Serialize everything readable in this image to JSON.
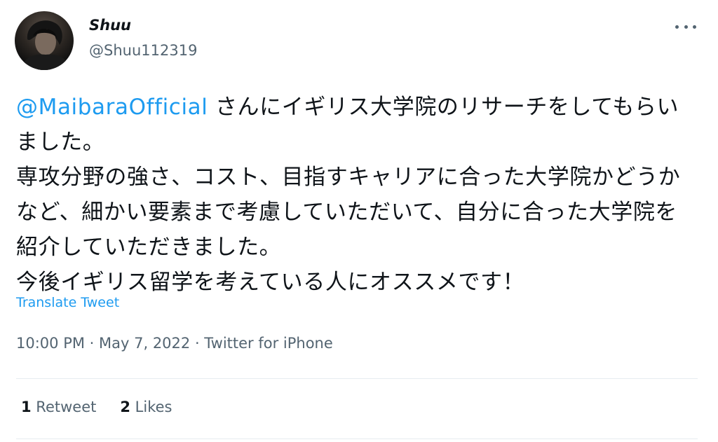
{
  "author": {
    "display_name": "Shuu",
    "handle": "@Shuu112319"
  },
  "tweet": {
    "mention": "@MaibaraOfficial",
    "text": " さんにイギリス大学院のリサーチをしてもらいました。\n専攻分野の強さ、コスト、目指すキャリアに合った大学院かどうかなど、細かい要素まで考慮していただいて、自分に合った大学院を紹介していただきました。\n今後イギリス留学を考えている人にオススメです！",
    "translate_label": "Translate Tweet"
  },
  "meta": {
    "time": "10:00 PM",
    "separator": " · ",
    "date": "May 7, 2022",
    "source": "Twitter for iPhone"
  },
  "stats": {
    "retweets_count": "1",
    "retweets_label": " Retweet",
    "likes_count": "2",
    "likes_label": " Likes"
  },
  "icons": {
    "more": "more-horizontal-icon",
    "avatar": "profile-photo"
  },
  "colors": {
    "link": "#1d9bf0",
    "secondary_text": "#536471",
    "primary_text": "#0f1419",
    "divider": "#e6ecf0"
  }
}
